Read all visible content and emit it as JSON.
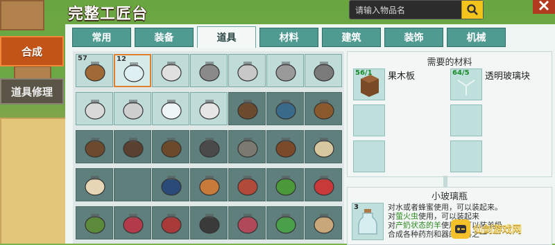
{
  "header": {
    "title": "完整工匠台",
    "search_placeholder": "请输入物品名"
  },
  "side_tabs": [
    {
      "label": "合成",
      "active": true
    },
    {
      "label": "道具修理",
      "active": false
    }
  ],
  "categories": [
    {
      "label": "常用",
      "active": false
    },
    {
      "label": "装备",
      "active": false
    },
    {
      "label": "道具",
      "active": true
    },
    {
      "label": "材料",
      "active": false
    },
    {
      "label": "建筑",
      "active": false
    },
    {
      "label": "装饰",
      "active": false
    },
    {
      "label": "机械",
      "active": false
    }
  ],
  "items": [
    {
      "icon": "wooden-bowl-icon",
      "count": "57",
      "dark": false
    },
    {
      "icon": "small-glass-bottle-icon",
      "count": "12",
      "dark": false,
      "selected": true
    },
    {
      "icon": "watering-can-icon",
      "count": "",
      "dark": false
    },
    {
      "icon": "boat-icon",
      "count": "",
      "dark": false
    },
    {
      "icon": "whistle-icon",
      "count": "",
      "dark": false
    },
    {
      "icon": "tool-icon",
      "count": "",
      "dark": false
    },
    {
      "icon": "grill-icon",
      "count": "",
      "dark": false
    },
    {
      "icon": "spray-bottle-icon",
      "count": "",
      "dark": false
    },
    {
      "icon": "pot-icon",
      "count": "",
      "dark": false
    },
    {
      "icon": "flask-icon",
      "count": "",
      "dark": false
    },
    {
      "icon": "potion-bottle-icon",
      "count": "",
      "dark": false
    },
    {
      "icon": "hammer-icon",
      "count": "",
      "dark": true
    },
    {
      "icon": "blue-hammer-icon",
      "count": "",
      "dark": true
    },
    {
      "icon": "copper-hammer-icon",
      "count": "",
      "dark": true
    },
    {
      "icon": "hammer-icon",
      "count": "",
      "dark": true
    },
    {
      "icon": "stove-icon",
      "count": "",
      "dark": true
    },
    {
      "icon": "furnace-icon",
      "count": "",
      "dark": true
    },
    {
      "icon": "bucket-icon",
      "count": "",
      "dark": true
    },
    {
      "icon": "stone-bowl-icon",
      "count": "",
      "dark": true
    },
    {
      "icon": "soil-tray-icon",
      "count": "",
      "dark": true
    },
    {
      "icon": "seed-bag-icon",
      "count": "",
      "dark": true
    },
    {
      "icon": "seed-pack-icon",
      "count": "",
      "dark": true
    },
    {
      "icon": "empty-icon",
      "count": "",
      "dark": true
    },
    {
      "icon": "spoon-icon",
      "count": "",
      "dark": true
    },
    {
      "icon": "bottle-icon",
      "count": "",
      "dark": true
    },
    {
      "icon": "meat-dish-icon",
      "count": "",
      "dark": true
    },
    {
      "icon": "vegetable-dish-icon",
      "count": "",
      "dark": true
    },
    {
      "icon": "juice-cup-icon",
      "count": "",
      "dark": true
    },
    {
      "icon": "salad-dish-icon",
      "count": "",
      "dark": true
    },
    {
      "icon": "berry-dish-icon",
      "count": "",
      "dark": true
    },
    {
      "icon": "meat-bowl-icon",
      "count": "",
      "dark": true
    },
    {
      "icon": "frying-pan-icon",
      "count": "",
      "dark": true
    },
    {
      "icon": "cake-icon",
      "count": "",
      "dark": true
    },
    {
      "icon": "green-dish-icon",
      "count": "",
      "dark": true
    },
    {
      "icon": "horn-icon",
      "count": "",
      "dark": true
    }
  ],
  "materials": {
    "title": "需要的材料",
    "slots": [
      {
        "count": "56/1",
        "name": "果木板",
        "icon": "wood-plank-icon"
      },
      {
        "count": "64/5",
        "name": "透明玻璃块",
        "icon": "glass-block-icon"
      }
    ]
  },
  "detail": {
    "title": "小玻璃瓶",
    "count": "3",
    "line1": "对水或者蜂蜜使用，可以装起来。",
    "line2_prefix": "对",
    "line2_hl": "萤火虫",
    "line2_suffix": "使用，可以装起来",
    "line3_prefix": "对",
    "line3_hl": "产奶状态的羊",
    "line3_suffix": "使用，可以装羊奶",
    "line4": "合成各种药剂和器的材料之一"
  },
  "watermark": {
    "text": "仙剑游戏网"
  },
  "colors": {
    "accent_orange": "#c25418",
    "teal_tab": "#4f9b92",
    "search_button": "#f3c51c",
    "highlight_green": "#2d8a1e"
  }
}
